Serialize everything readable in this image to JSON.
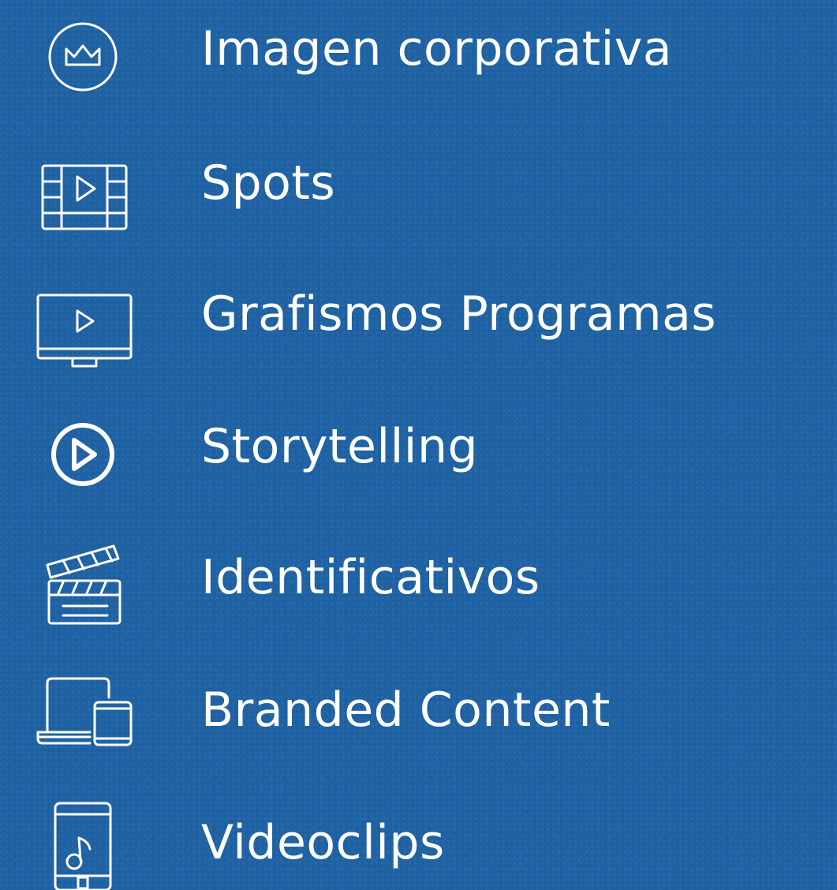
{
  "services": [
    {
      "icon": "crown-icon",
      "label": "Imagen corporativa"
    },
    {
      "icon": "film-strip-play-icon",
      "label": "Spots"
    },
    {
      "icon": "monitor-play-icon",
      "label": "Grafismos Programas"
    },
    {
      "icon": "play-circle-icon",
      "label": "Storytelling"
    },
    {
      "icon": "clapperboard-icon",
      "label": "Identificativos"
    },
    {
      "icon": "laptop-phone-icon",
      "label": "Branded Content"
    },
    {
      "icon": "phone-music-icon",
      "label": "Videoclips"
    }
  ],
  "colors": {
    "background": "#1f62a3",
    "text": "#ffffff"
  }
}
